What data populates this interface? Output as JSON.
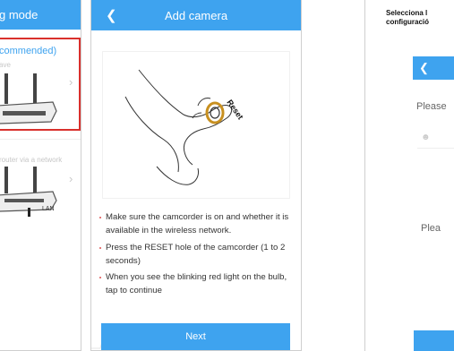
{
  "panel1": {
    "title": "g mode",
    "option1": {
      "label": "commended)",
      "sub": "ave"
    },
    "option2": {
      "sub": "router via a network",
      "lan_label": "LAN"
    }
  },
  "panel2": {
    "back_icon": "chevron-left-icon",
    "title": "Add camera",
    "illustration_label": "Reset",
    "instructions": [
      "Make sure the camcorder is on and whether it is available in the wireless network.",
      "Press the RESET hole of the camcorder (1 to 2 seconds)",
      "When you see the blinking red light on the bulb, tap to continue"
    ],
    "next_label": "Next"
  },
  "panel3": {
    "caption_line1": "Selecciona l",
    "caption_line2": "configuració",
    "back_icon": "chevron-left-icon",
    "please_top": "Please",
    "please_mid": "Plea",
    "user_icon": "user-icon"
  },
  "colors": {
    "accent": "#3ea3ef",
    "highlight": "#d9302c"
  }
}
